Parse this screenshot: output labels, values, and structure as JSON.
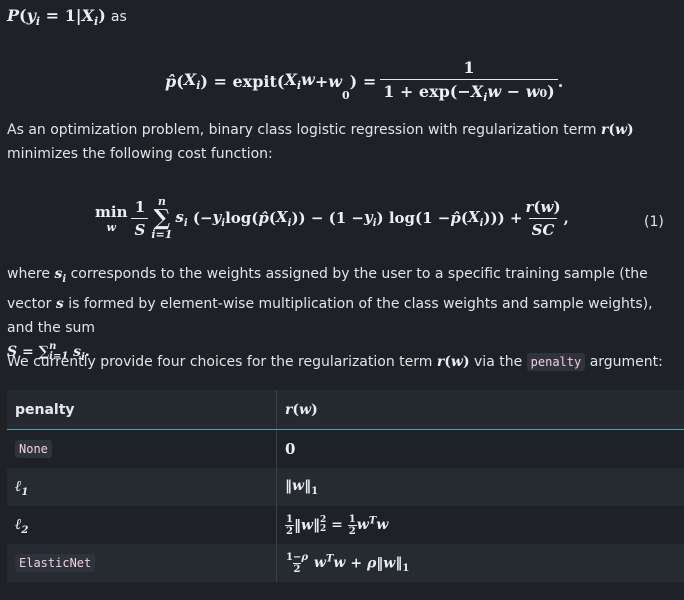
{
  "header_line": {
    "suffix": "as"
  },
  "para_optimization": {
    "before": "As an optimization problem, binary class logistic regression with regularization term",
    "after": "minimizes the following cost function:"
  },
  "equation_number": "(1)",
  "para_where": {
    "t1": "where",
    "t2": "corresponds to the weights assigned by the user to a specific training sample (the vector",
    "t3": "is formed by element-wise multiplication of the class weights and sample weights), and the sum"
  },
  "para_choices": {
    "before": "We currently provide four choices for the regularization term",
    "mid": "via the",
    "code": "penalty",
    "after": "argument:"
  },
  "table": {
    "headers": [
      "penalty",
      "r(w)"
    ],
    "rows": [
      {
        "penalty": "None",
        "penalty_is_code": true,
        "value": "0"
      },
      {
        "penalty": "ℓ1",
        "penalty_is_code": false,
        "value": "‖w‖1"
      },
      {
        "penalty": "ℓ2",
        "penalty_is_code": false,
        "value": "½‖w‖²₂ = ½wᵀw"
      },
      {
        "penalty": "ElasticNet",
        "penalty_is_code": true,
        "value": "(1−ρ)/2 wᵀw + ρ‖w‖1"
      }
    ]
  },
  "colors": {
    "background": "#1e2227",
    "table_header_rule": "#3fa6b7",
    "code_bg": "#2f343c",
    "code_fg": "#f1cfe0"
  }
}
